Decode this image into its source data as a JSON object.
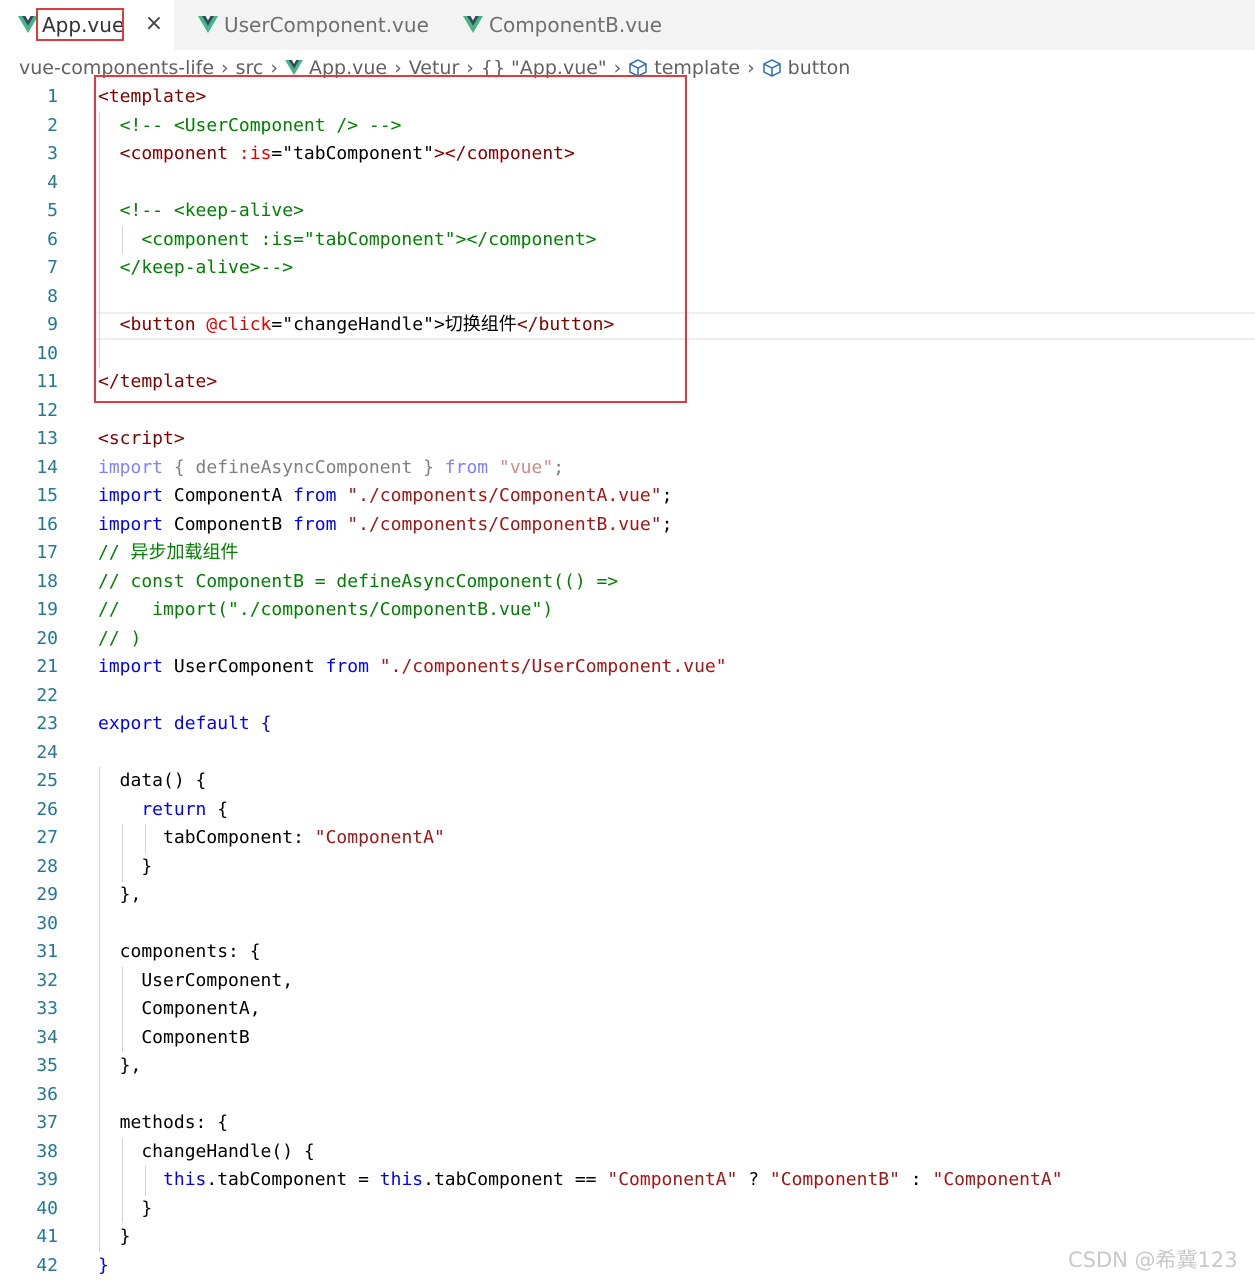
{
  "tabs": [
    {
      "label": "App.vue",
      "active": true
    },
    {
      "label": "UserComponent.vue",
      "active": false
    },
    {
      "label": "ComponentB.vue",
      "active": false
    }
  ],
  "tab_close_glyph": "×",
  "breadcrumb": [
    "vue-components-life",
    "src",
    "App.vue",
    "Vetur",
    "\"App.vue\"",
    "template",
    "button"
  ],
  "breadcrumb_icons": [
    "",
    "",
    "vue-icon",
    "",
    "braces-icon",
    "cube-icon",
    "cube-icon"
  ],
  "braces_glyph": "{}",
  "colors": {
    "tag": "#800000",
    "attr": "#e50000",
    "keyword": "#0000ff",
    "string": "#a31515",
    "comment": "#008000",
    "plain": "#000000",
    "dim_keyword": "#7f7fff",
    "dim_plain": "#7f7f7f",
    "dim_string": "#d18a8a",
    "line_number": "#237893",
    "highlight_box": "#e0393e",
    "vue_green": "#41b883"
  },
  "code_lines": [
    [
      [
        "<template>",
        "tag"
      ]
    ],
    [
      [
        "  <!-- <UserComponent /> -->",
        "comment"
      ]
    ],
    [
      [
        "  <component ",
        "tag"
      ],
      [
        ":is",
        "attr"
      ],
      [
        "=",
        "plain"
      ],
      [
        "\"tabComponent\"",
        "plain"
      ],
      [
        "></component>",
        "tag"
      ]
    ],
    [],
    [
      [
        "  <!-- <keep-alive>",
        "comment"
      ]
    ],
    [
      [
        "    <component :is=\"tabComponent\"></component>",
        "comment"
      ]
    ],
    [
      [
        "  </keep-alive>-->",
        "comment"
      ]
    ],
    [],
    [
      [
        "  <button ",
        "tag"
      ],
      [
        "@click",
        "attr"
      ],
      [
        "=",
        "plain"
      ],
      [
        "\"changeHandle\"",
        "plain"
      ],
      [
        ">切换组件",
        "plain"
      ],
      [
        "</button>",
        "tag"
      ]
    ],
    [],
    [
      [
        "</template>",
        "tag"
      ]
    ],
    [],
    [
      [
        "<script>",
        "tag"
      ]
    ],
    [
      [
        "import",
        "dim_keyword"
      ],
      [
        " { defineAsyncComponent } ",
        "dim_plain"
      ],
      [
        "from",
        "dim_keyword"
      ],
      [
        " ",
        "dim_plain"
      ],
      [
        "\"vue\"",
        "dim_string"
      ],
      [
        ";",
        "dim_plain"
      ]
    ],
    [
      [
        "import",
        "keyword"
      ],
      [
        " ComponentA ",
        "plain"
      ],
      [
        "from",
        "keyword"
      ],
      [
        " ",
        "plain"
      ],
      [
        "\"./components/ComponentA.vue\"",
        "string"
      ],
      [
        ";",
        "plain"
      ]
    ],
    [
      [
        "import",
        "keyword"
      ],
      [
        " ComponentB ",
        "plain"
      ],
      [
        "from",
        "keyword"
      ],
      [
        " ",
        "plain"
      ],
      [
        "\"./components/ComponentB.vue\"",
        "string"
      ],
      [
        ";",
        "plain"
      ]
    ],
    [
      [
        "// 异步加载组件",
        "comment"
      ]
    ],
    [
      [
        "// const ComponentB = defineAsyncComponent(() =>",
        "comment"
      ]
    ],
    [
      [
        "//   import(\"./components/ComponentB.vue\")",
        "comment"
      ]
    ],
    [
      [
        "// )",
        "comment"
      ]
    ],
    [
      [
        "import",
        "keyword"
      ],
      [
        " UserComponent ",
        "plain"
      ],
      [
        "from",
        "keyword"
      ],
      [
        " ",
        "plain"
      ],
      [
        "\"./components/UserComponent.vue\"",
        "string"
      ]
    ],
    [],
    [
      [
        "export",
        "keyword"
      ],
      [
        " ",
        "plain"
      ],
      [
        "default",
        "keyword"
      ],
      [
        " {",
        "keyword"
      ]
    ],
    [],
    [
      [
        "  data",
        "plain"
      ],
      [
        "()",
        "plain"
      ],
      [
        " {",
        "plain"
      ]
    ],
    [
      [
        "    return",
        "keyword"
      ],
      [
        " {",
        "plain"
      ]
    ],
    [
      [
        "      tabComponent: ",
        "plain"
      ],
      [
        "\"ComponentA\"",
        "string"
      ]
    ],
    [
      [
        "    }",
        "plain"
      ]
    ],
    [
      [
        "  },",
        "plain"
      ]
    ],
    [],
    [
      [
        "  components: ",
        "plain"
      ],
      [
        "{",
        "plain"
      ]
    ],
    [
      [
        "    UserComponent,",
        "plain"
      ]
    ],
    [
      [
        "    ComponentA,",
        "plain"
      ]
    ],
    [
      [
        "    ComponentB",
        "plain"
      ]
    ],
    [
      [
        "  },",
        "plain"
      ]
    ],
    [],
    [
      [
        "  methods: ",
        "plain"
      ],
      [
        "{",
        "plain"
      ]
    ],
    [
      [
        "    changeHandle",
        "plain"
      ],
      [
        "()",
        "plain"
      ],
      [
        " {",
        "plain"
      ]
    ],
    [
      [
        "      this",
        "keyword"
      ],
      [
        ".tabComponent = ",
        "plain"
      ],
      [
        "this",
        "keyword"
      ],
      [
        ".tabComponent == ",
        "plain"
      ],
      [
        "\"ComponentA\"",
        "string"
      ],
      [
        " ? ",
        "plain"
      ],
      [
        "\"ComponentB\"",
        "string"
      ],
      [
        " : ",
        "plain"
      ],
      [
        "\"ComponentA\"",
        "string"
      ]
    ],
    [
      [
        "    }",
        "plain"
      ]
    ],
    [
      [
        "  }",
        "plain"
      ]
    ],
    [
      [
        "}",
        "keyword"
      ]
    ]
  ],
  "watermark": "CSDN @希冀123"
}
